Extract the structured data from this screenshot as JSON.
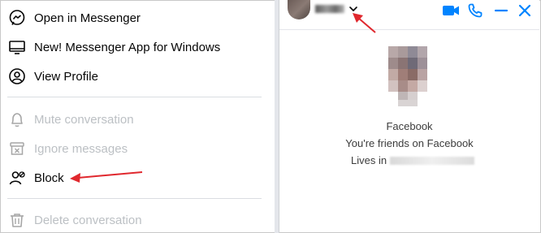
{
  "menu": {
    "items": [
      {
        "label": "Open in Messenger",
        "icon": "messenger-icon",
        "disabled": false
      },
      {
        "label": "New! Messenger App for Windows",
        "icon": "desktop-icon",
        "disabled": false
      },
      {
        "label": "View Profile",
        "icon": "profile-icon",
        "disabled": false
      },
      {
        "label": "Mute conversation",
        "icon": "bell-icon",
        "disabled": true
      },
      {
        "label": "Ignore messages",
        "icon": "ignore-icon",
        "disabled": true
      },
      {
        "label": "Block",
        "icon": "block-user-icon",
        "disabled": false
      },
      {
        "label": "Delete conversation",
        "icon": "trash-icon",
        "disabled": true
      }
    ]
  },
  "chat": {
    "source": "Facebook",
    "friends_text": "You're friends on Facebook",
    "lives_in_label": "Lives in"
  },
  "header": {
    "icons": [
      "chevron-down-icon",
      "video-call-icon",
      "phone-call-icon",
      "minimize-icon",
      "close-icon"
    ]
  },
  "colors": {
    "accent": "#0084ff",
    "arrow": "#e0282e",
    "disabled_text": "#bcc0c4"
  }
}
